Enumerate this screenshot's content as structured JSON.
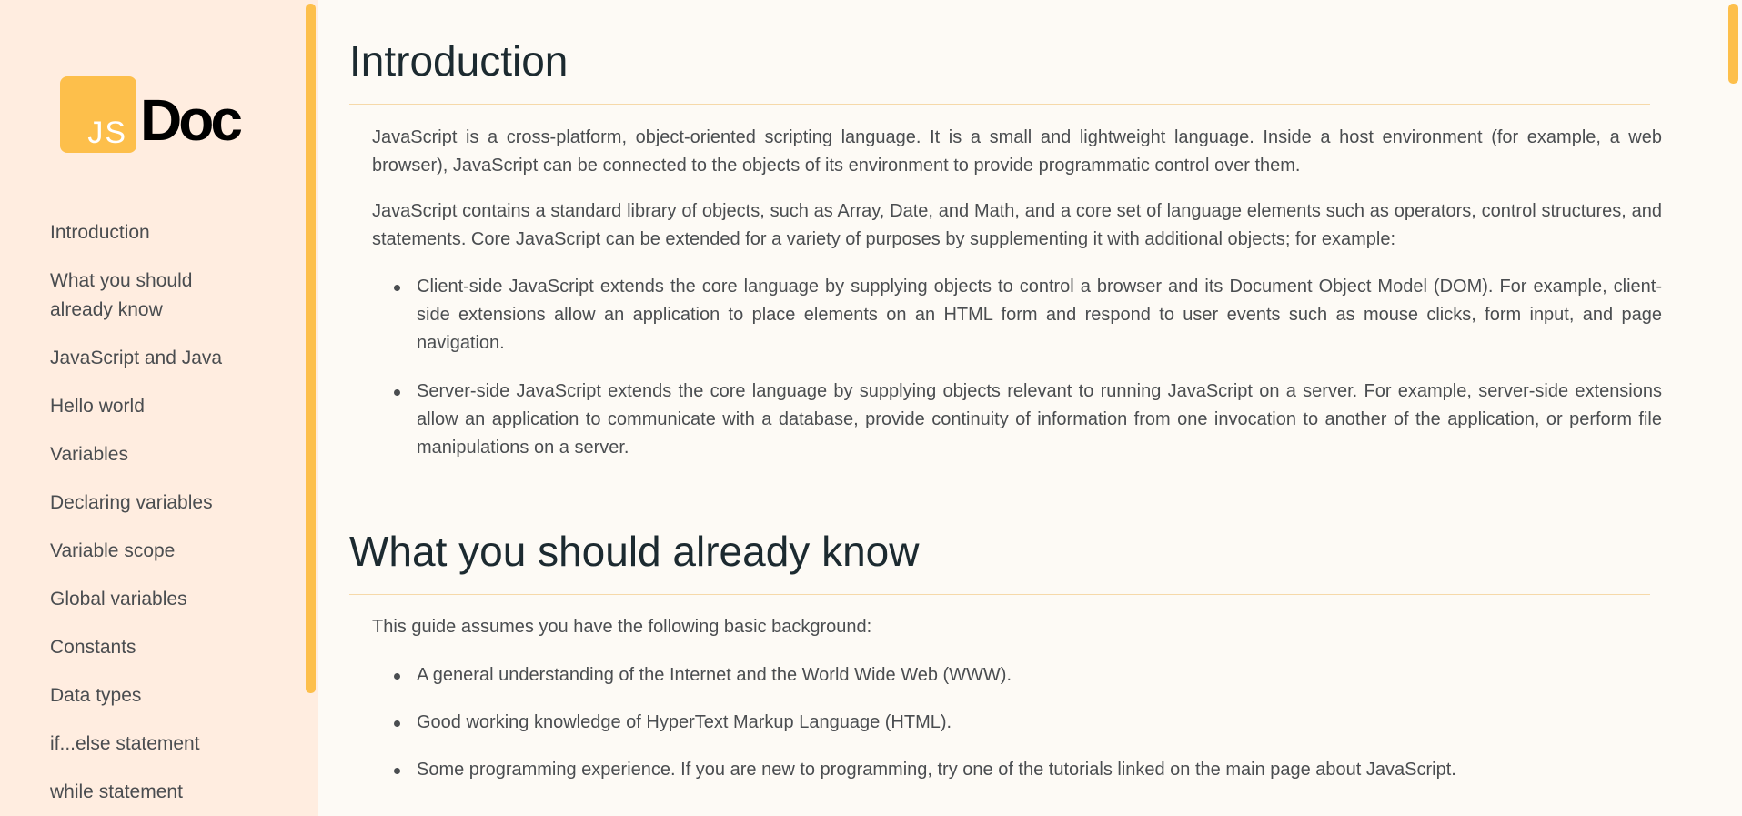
{
  "logo": {
    "badge_text": "JS",
    "word": "Doc"
  },
  "sidebar": {
    "items": [
      {
        "label": "Introduction"
      },
      {
        "label": "What you should already know"
      },
      {
        "label": "JavaScript and Java"
      },
      {
        "label": "Hello world"
      },
      {
        "label": "Variables"
      },
      {
        "label": "Declaring variables"
      },
      {
        "label": "Variable scope"
      },
      {
        "label": "Global variables"
      },
      {
        "label": "Constants"
      },
      {
        "label": "Data types"
      },
      {
        "label": "if...else statement"
      },
      {
        "label": "while statement"
      }
    ]
  },
  "sections": {
    "intro": {
      "title": "Introduction",
      "p1": "JavaScript is a cross-platform, object-oriented scripting language. It is a small and lightweight language. Inside a host environment (for example, a web browser), JavaScript can be connected to the objects of its environment to provide programmatic control over them.",
      "p2": "JavaScript contains a standard library of objects, such as Array, Date, and Math, and a core set of language elements such as operators, control structures, and statements. Core JavaScript can be extended for a variety of purposes by supplementing it with additional objects; for example:",
      "bullets": [
        "Client-side JavaScript extends the core language by supplying objects to control a browser and its Document Object Model (DOM). For example, client-side extensions allow an application to place elements on an HTML form and respond to user events such as mouse clicks, form input, and page navigation.",
        "Server-side JavaScript extends the core language by supplying objects relevant to running JavaScript on a server. For example, server-side extensions allow an application to communicate with a database, provide continuity of information from one invocation to another of the application, or perform file manipulations on a server."
      ]
    },
    "know": {
      "title": "What you should already know",
      "p1": "This guide assumes you have the following basic background:",
      "bullets": [
        "A general understanding of the Internet and the World Wide Web (WWW).",
        "Good working knowledge of HyperText Markup Language (HTML).",
        "Some programming experience. If you are new to programming, try one of the tutorials linked on the main page about JavaScript."
      ]
    }
  },
  "colors": {
    "sidebar_bg": "#ffede0",
    "main_bg": "#fdfaf5",
    "accent": "#fdbf4b",
    "heading": "#1c2a30",
    "text": "#4a4d50",
    "rule": "#f6d9a9"
  }
}
